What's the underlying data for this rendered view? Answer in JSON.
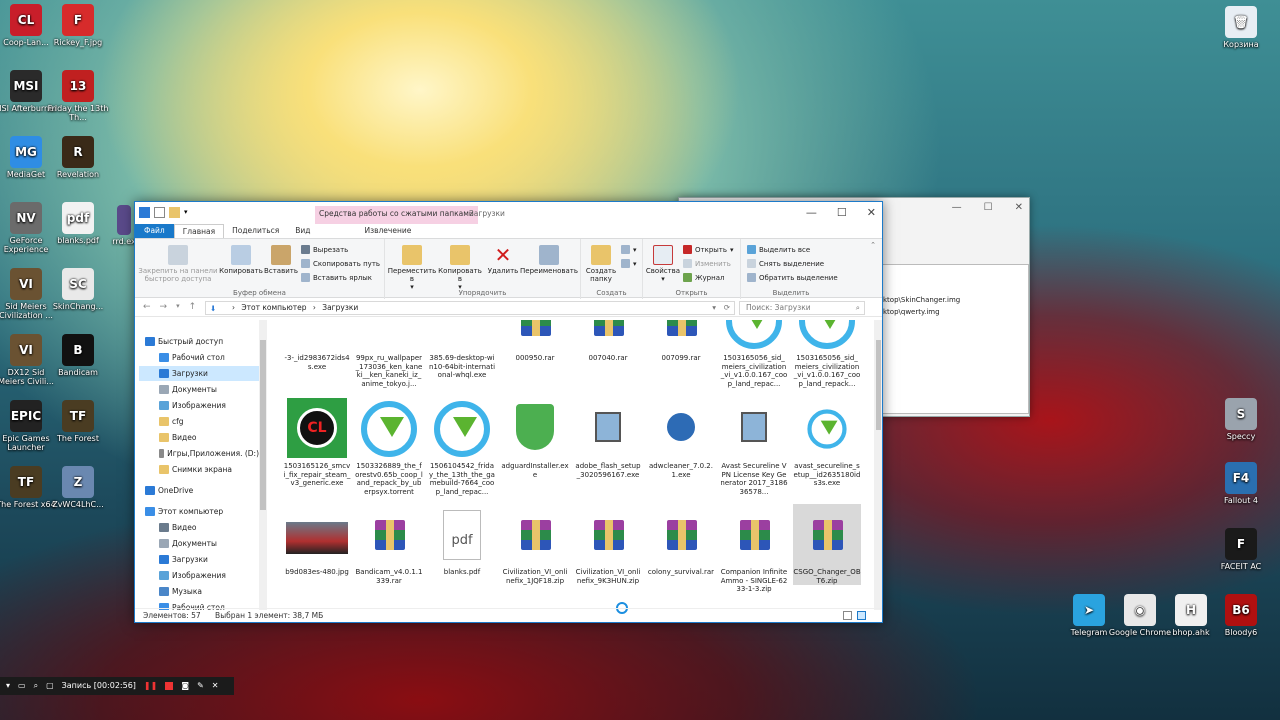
{
  "desktop": {
    "left_icons": [
      {
        "label": "Coop-Lan...",
        "color": "#c81e2a",
        "glyph": "CL"
      },
      {
        "label": "Rickey_F.jpg",
        "color": "#d72b2b",
        "glyph": "F"
      },
      {
        "label": "MSI Afterburner",
        "color": "#2a2a2a",
        "glyph": "MSI"
      },
      {
        "label": "Friday the 13th Th...",
        "color": "#c02020",
        "glyph": "13"
      },
      {
        "label": "MediaGet",
        "color": "#2f8de4",
        "glyph": "MG"
      },
      {
        "label": "Revelation",
        "color": "#3a2a18",
        "glyph": "R"
      },
      {
        "label": "GeForce Experience",
        "color": "#6b6b6b",
        "glyph": "NV"
      },
      {
        "label": "blanks.pdf",
        "color": "#f2f2f2",
        "glyph": "pdf"
      },
      {
        "label": "Sid Meiers Civilization ...",
        "color": "#6a5232",
        "glyph": "VI"
      },
      {
        "label": "SkinChang...",
        "color": "#e9e9e9",
        "glyph": "SC"
      },
      {
        "label": "DX12 Sid Meiers Civili...",
        "color": "#6a5232",
        "glyph": "VI"
      },
      {
        "label": "Bandicam",
        "color": "#111111",
        "glyph": "B"
      },
      {
        "label": "Epic Games Launcher",
        "color": "#222222",
        "glyph": "EPIC"
      },
      {
        "label": "The Forest",
        "color": "#4a3c22",
        "glyph": "TF"
      },
      {
        "label": "The Forest x64",
        "color": "#4a3c22",
        "glyph": "TF"
      },
      {
        "label": "ZvWC4LhC...",
        "color": "#6a88b0",
        "glyph": "Z"
      }
    ],
    "partial_icon_label": "rrd.ex",
    "right_icons": [
      {
        "label": "Корзина",
        "color": "#e8eef4",
        "glyph": "🗑"
      },
      {
        "label": "Speccy",
        "color": "#9aa3ad",
        "glyph": "S"
      },
      {
        "label": "Fallout 4",
        "color": "#2a6fb0",
        "glyph": "F4"
      },
      {
        "label": "FACEIT AC",
        "color": "#1a1a1a",
        "glyph": "F"
      }
    ],
    "bottom_icons": [
      {
        "label": "Telegram",
        "color": "#2aa3df",
        "glyph": "➤"
      },
      {
        "label": "Google Chrome",
        "color": "#e8e8e8",
        "glyph": "◉"
      },
      {
        "label": "bhop.ahk",
        "color": "#f0f0f0",
        "glyph": "H"
      },
      {
        "label": "Bloody6",
        "color": "#b01010",
        "glyph": "B6"
      }
    ]
  },
  "bg_window": {
    "line1": "ktop\\SkinChanger.img",
    "line2": "ktop\\qwerty.img"
  },
  "explorer": {
    "context_tab": "Средства работы со сжатыми папками",
    "title": "Загрузки",
    "tabs": [
      "Файл",
      "Главная",
      "Поделиться",
      "Вид",
      "Извлечение"
    ],
    "ribbon": {
      "pin": "Закрепить на панели быстрого доступа",
      "copy": "Копировать",
      "paste": "Вставить",
      "cut": "Вырезать",
      "copy_path": "Скопировать путь",
      "paste_shortcut": "Вставить ярлык",
      "group_clipboard": "Буфер обмена",
      "move_to": "Переместить в",
      "copy_to": "Копировать в",
      "delete": "Удалить",
      "rename": "Переименовать",
      "group_organize": "Упорядочить",
      "new_folder": "Создать папку",
      "group_create": "Создать",
      "properties": "Свойства",
      "open": "Открыть",
      "edit": "Изменить",
      "history": "Журнал",
      "group_open": "Открыть",
      "select_all": "Выделить все",
      "select_none": "Снять выделение",
      "invert": "Обратить выделение",
      "group_select": "Выделить"
    },
    "address": {
      "root": "Этот компьютер",
      "sep": "›",
      "folder": "Загрузки",
      "search_placeholder": "Поиск: Загрузки"
    },
    "nav": [
      {
        "label": "Быстрый доступ",
        "color": "#2b7ad6",
        "indent": 0
      },
      {
        "label": "Рабочий стол",
        "color": "#3a8ee6",
        "indent": 1
      },
      {
        "label": "Загрузки",
        "color": "#2b7ad6",
        "indent": 1,
        "selected": true
      },
      {
        "label": "Документы",
        "color": "#9aa7b5",
        "indent": 1
      },
      {
        "label": "Изображения",
        "color": "#5aa3d8",
        "indent": 1
      },
      {
        "label": "cfg",
        "color": "#e9c46a",
        "indent": 1
      },
      {
        "label": "Видео",
        "color": "#e9c46a",
        "indent": 1
      },
      {
        "label": "Игры,Приложения. (D:)",
        "color": "#8a8a8a",
        "indent": 1
      },
      {
        "label": "Снимки экрана",
        "color": "#e9c46a",
        "indent": 1
      },
      {
        "label": "OneDrive",
        "color": "#2b7ad6",
        "indent": 0
      },
      {
        "label": "Этот компьютер",
        "color": "#3a8ee6",
        "indent": 0
      },
      {
        "label": "Видео",
        "color": "#6a7b8c",
        "indent": 1
      },
      {
        "label": "Документы",
        "color": "#9aa7b5",
        "indent": 1
      },
      {
        "label": "Загрузки",
        "color": "#2b7ad6",
        "indent": 1
      },
      {
        "label": "Изображения",
        "color": "#5aa3d8",
        "indent": 1
      },
      {
        "label": "Музыка",
        "color": "#4a86c8",
        "indent": 1
      },
      {
        "label": "Рабочий стол",
        "color": "#3a8ee6",
        "indent": 1
      }
    ],
    "files": [
      {
        "name": "-3-_id2983672ids4s.exe",
        "kind": "exe"
      },
      {
        "name": "99px_ru_wallpaper_173036_ken_kaneki__ken_kaneki_iz_anime_tokyo.j...",
        "kind": "img-dark"
      },
      {
        "name": "385.69-desktop-win10-64bit-international-whql.exe",
        "kind": "shield"
      },
      {
        "name": "000950.rar",
        "kind": "rar"
      },
      {
        "name": "007040.rar",
        "kind": "rar"
      },
      {
        "name": "007099.rar",
        "kind": "rar"
      },
      {
        "name": "1503165056_sid_meiers_civilization_vi_v1.0.0.167_coop_land_repac...",
        "kind": "circ"
      },
      {
        "name": "1503165056_sid_meiers_civilization_vi_v1.0.0.167_coop_land_repack...",
        "kind": "circ"
      },
      {
        "name": "1503165126_smcvi_fix_repair_steam_v3_generic.exe",
        "kind": "cl"
      },
      {
        "name": "1503326889_the_forestv0.65b_coop_land_repack_by_uberpsyx.torrent",
        "kind": "circ"
      },
      {
        "name": "1506104542_friday_the_13th_the_gamebuild-7664_coop_land_repac...",
        "kind": "circ"
      },
      {
        "name": "adguardInstaller.exe",
        "kind": "adguard"
      },
      {
        "name": "adobe_flash_setup_3020596167.exe",
        "kind": "setup"
      },
      {
        "name": "adwcleaner_7.0.2.1.exe",
        "kind": "adw"
      },
      {
        "name": "Avast Secureline VPN License Key Generator 2017_318636578...",
        "kind": "setup"
      },
      {
        "name": "avast_secureline_setup__id2635180ids3s.exe",
        "kind": "circsmall"
      },
      {
        "name": "b9d083es-480.jpg",
        "kind": "car"
      },
      {
        "name": "Bandicam_v4.0.1.1339.rar",
        "kind": "rar"
      },
      {
        "name": "blanks.pdf",
        "kind": "pdf"
      },
      {
        "name": "Civilization_VI_onlinefix_1JQF18.zip",
        "kind": "rar"
      },
      {
        "name": "Civilization_VI_onlinefix_9K3HUN.zip",
        "kind": "rar"
      },
      {
        "name": "colony_survival.rar",
        "kind": "rar"
      },
      {
        "name": "Companion Infinite Ammo - SINGLE-6233-1-3.zip",
        "kind": "rar"
      },
      {
        "name": "CSGO_Changer_OBT6.zip",
        "kind": "rar",
        "selected": true
      }
    ],
    "status": {
      "count": "Элементов: 57",
      "selected": "Выбран 1 элемент: 38,7 МБ"
    }
  },
  "recorder": {
    "label": "Запись [00:02:56]"
  }
}
